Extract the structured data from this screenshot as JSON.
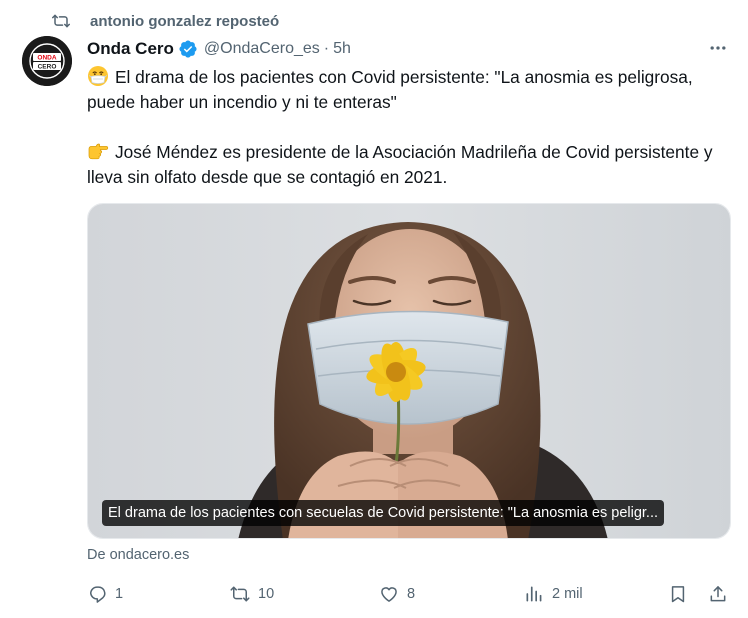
{
  "repost": {
    "text": "antonio gonzalez reposteó",
    "icon": "repost-icon"
  },
  "author": {
    "name": "Onda Cero",
    "handle": "@OndaCero_es",
    "separator": "·",
    "time": "5h",
    "verified": true,
    "avatar_icon": "onda-cero-logo",
    "logo_text": [
      "ONDA",
      "CERO"
    ]
  },
  "tweet": {
    "line1_emoji": "face-with-medical-mask",
    "line1": "El drama de los pacientes con Covid persistente: \"La anosmia es peligrosa, puede haber un incendio y ni te enteras\"",
    "line2_emoji": "backhand-index-pointing-right",
    "line2": "José Méndez es presidente de la Asociación Madrileña de Covid persistente y lleva sin olfato desde que se contagió en 2021."
  },
  "media": {
    "caption": "El drama de los pacientes con secuelas de Covid persistente: \"La anosmia es peligr..."
  },
  "source": "De ondacero.es",
  "actions": {
    "reply": {
      "count": "1",
      "icon": "reply-icon"
    },
    "repost": {
      "count": "10",
      "icon": "repost-icon"
    },
    "like": {
      "count": "8",
      "icon": "heart-icon"
    },
    "views": {
      "count": "2 mil",
      "icon": "views-icon"
    },
    "bookmark": {
      "icon": "bookmark-icon"
    },
    "share": {
      "icon": "share-icon"
    }
  },
  "colors": {
    "text": "#0f1419",
    "secondary": "#536471",
    "verified": "#1d9bf0",
    "brand": "#e30613"
  }
}
